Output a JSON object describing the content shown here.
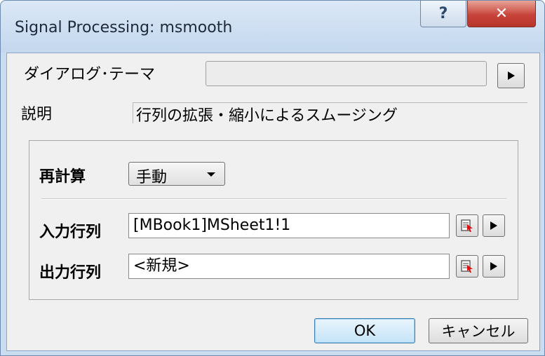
{
  "window": {
    "title": "Signal Processing: msmooth",
    "help_glyph": "?",
    "close_glyph": "✕"
  },
  "dialog_theme": {
    "label": "ダイアログ･テーマ",
    "value": ""
  },
  "description": {
    "label": "説明",
    "text": "行列の拡張・縮小によるスムージング"
  },
  "recalc": {
    "label": "再計算",
    "selected": "手動"
  },
  "input_matrix": {
    "label": "入力行列",
    "value": "[MBook1]MSheet1!1"
  },
  "output_matrix": {
    "label": "出力行列",
    "value": "<新規>"
  },
  "buttons": {
    "ok": "OK",
    "cancel": "キャンセル"
  },
  "icons": [
    "help-icon",
    "close-icon",
    "play-arrow-icon",
    "dropdown-arrow-icon",
    "matrix-browse-icon"
  ]
}
